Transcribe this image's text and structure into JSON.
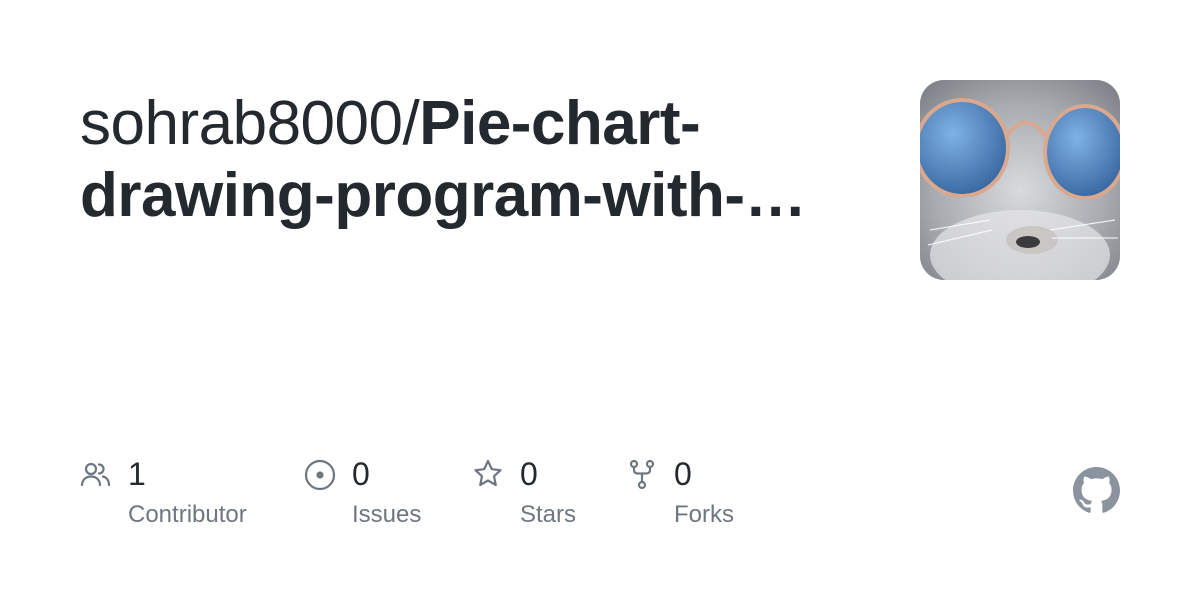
{
  "title": {
    "owner": "sohrab8000/",
    "repo": "Pie-chart-drawing-program-with-…"
  },
  "avatar": {
    "subject": "cat-with-sunglasses"
  },
  "stats": {
    "contributors": {
      "value": "1",
      "label": "Contributor",
      "icon": "people-icon"
    },
    "issues": {
      "value": "0",
      "label": "Issues",
      "icon": "issue-circle-icon"
    },
    "stars": {
      "value": "0",
      "label": "Stars",
      "icon": "star-icon"
    },
    "forks": {
      "value": "0",
      "label": "Forks",
      "icon": "fork-icon"
    }
  },
  "colors": {
    "text": "#24292f",
    "muted": "#6e7781",
    "icon": "#6e7781",
    "logo": "#8b949e"
  },
  "logo": {
    "icon": "github-logo-icon"
  }
}
